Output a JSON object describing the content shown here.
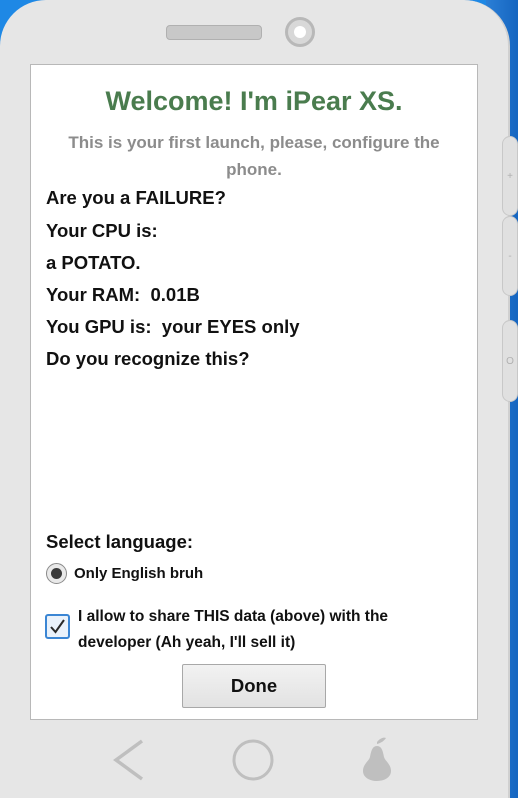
{
  "screen": {
    "title": "Welcome! I'm iPear XS.",
    "subtitle": "This is your first launch, please, configure the phone."
  },
  "info": {
    "failure": "Are you a FAILURE?",
    "cpu_label": "Your CPU is:",
    "cpu_value": "a POTATO.",
    "ram_line": "Your RAM:  0.01B",
    "gpu_line": "You GPU is:  your EYES only",
    "recognize": "Do you recognize this?"
  },
  "language": {
    "label": "Select language:",
    "options": [
      {
        "label": "Only English bruh",
        "selected": true
      }
    ]
  },
  "consent": {
    "label": "I allow to share THIS data (above) with the developer (Ah yeah, I'll sell it)",
    "checked": true
  },
  "buttons": {
    "done": "Done"
  },
  "side_buttons": {
    "volume_up": "+",
    "volume_down": "-",
    "power": "O"
  },
  "nav": {
    "back_icon": "back-chevron",
    "home_icon": "home-circle",
    "menu_icon": "pear-logo"
  },
  "colors": {
    "title": "#4a7c4e",
    "subtitle": "#8c8c8c",
    "background": "#1e88e5",
    "phone_body": "#e6e6e6",
    "checkbox_border": "#3b86d4"
  }
}
